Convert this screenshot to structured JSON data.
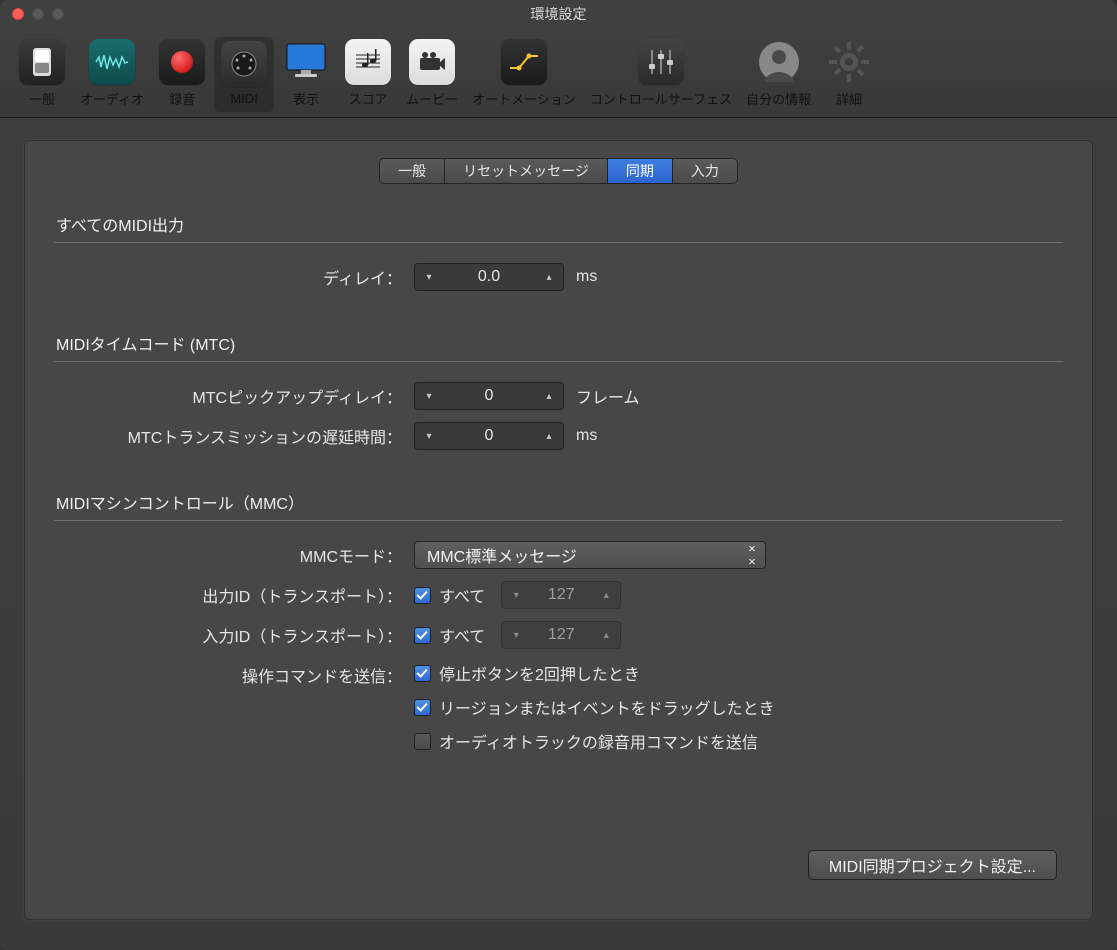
{
  "window_title": "環境設定",
  "toolbar": {
    "items": [
      {
        "label": "一般"
      },
      {
        "label": "オーディオ"
      },
      {
        "label": "録音"
      },
      {
        "label": "MIDI"
      },
      {
        "label": "表示"
      },
      {
        "label": "スコア"
      },
      {
        "label": "ムービー"
      },
      {
        "label": "オートメーション"
      },
      {
        "label": "コントロールサーフェス"
      },
      {
        "label": "自分の情報"
      },
      {
        "label": "詳細"
      }
    ]
  },
  "tabs": {
    "items": [
      {
        "label": "一般"
      },
      {
        "label": "リセットメッセージ"
      },
      {
        "label": "同期"
      },
      {
        "label": "入力"
      }
    ]
  },
  "sections": {
    "all_midi_out": {
      "title": "すべてのMIDI出力",
      "delay_label": "ディレイ：",
      "delay_value": "0.0",
      "delay_unit": "ms"
    },
    "mtc": {
      "title": "MIDIタイムコード (MTC)",
      "pickup_label": "MTCピックアップディレイ：",
      "pickup_value": "0",
      "pickup_unit": "フレーム",
      "trans_label": "MTCトランスミッションの遅延時間：",
      "trans_value": "0",
      "trans_unit": "ms"
    },
    "mmc": {
      "title": "MIDIマシンコントロール（MMC）",
      "mode_label": "MMCモード：",
      "mode_value": "MMC標準メッセージ",
      "out_id_label": "出力ID（トランスポート）：",
      "out_all_label": "すべて",
      "out_id_value": "127",
      "in_id_label": "入力ID（トランスポート）：",
      "in_all_label": "すべて",
      "in_id_value": "127",
      "send_cmd_label": "操作コマンドを送信：",
      "opt1": "停止ボタンを2回押したとき",
      "opt2": "リージョンまたはイベントをドラッグしたとき",
      "opt3": "オーディオトラックの録音用コマンドを送信"
    }
  },
  "footer_button": "MIDI同期プロジェクト設定..."
}
